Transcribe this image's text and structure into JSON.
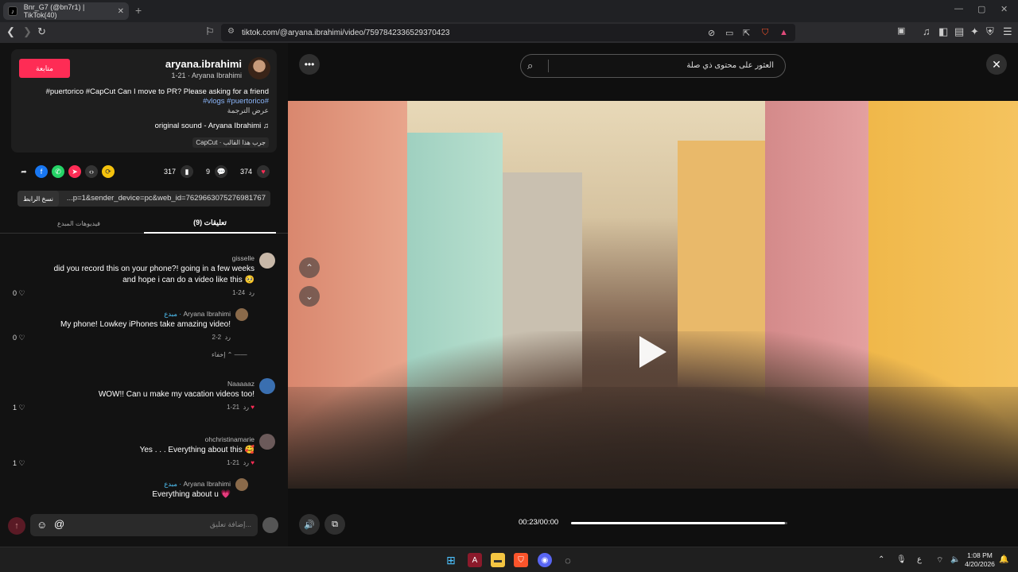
{
  "browser": {
    "tab_title": "Bnr_G7 (@bn7r1) | TikTok(40)",
    "url": "tiktok.com/@aryana.ibrahimi/video/7597842336529370423",
    "new_tab": "+",
    "close_tab": "✕"
  },
  "post": {
    "follow_label": "متابعة",
    "username": "aryana.ibrahimi",
    "subline": "1-21 · Aryana Ibrahimi",
    "desc_main": "#puertorico #CapCut Can I move to PR? Please asking for a friend",
    "desc_tags": "#vlogs #puertorico#",
    "translate": "عرض الترجمة",
    "sound": "original sound - Aryana Ibrahimi ♫",
    "capcut": "CapCut · جرب هذا القالب",
    "likes": "374",
    "comments_count": "9",
    "saves": "317",
    "copy_link": "نسخ الرابط",
    "link": "...p=1&sender_device=pc&web_id=7629663075276981767",
    "tab_comments": "تعليقات (9)",
    "tab_creator": "فيديوهات المبدع"
  },
  "comments": [
    {
      "name": "gisselle",
      "text1": "did you record this on your phone?! going in a few weeks",
      "text2": "and hope i can do a video like this 🥺",
      "date": "1-24",
      "reply": "رد",
      "likes": "0"
    },
    {
      "name": "Aryana Ibrahimi",
      "creator": "مبدع ·",
      "text1": "My phone! Lowkey iPhones take amazing video!",
      "date": "2-2",
      "reply": "رد",
      "likes": "0",
      "hide": "إخفاء ⌃"
    },
    {
      "name": "Naaaaaz",
      "text1": "WOW!! Can u make my vacation videos too!",
      "date": "1-21",
      "reply": "رد",
      "likes": "1"
    },
    {
      "name": "ohchristinamarie",
      "text1": "Yes . . . Everything about this 🥰",
      "date": "1-21",
      "reply": "رد",
      "likes": "1"
    },
    {
      "name": "Aryana Ibrahimi",
      "creator": "مبدع ·",
      "text1": "Everything about u 💗"
    }
  ],
  "input": {
    "placeholder": "إضافة تعليق..."
  },
  "video": {
    "search_placeholder": "العثور على محتوى ذي صلة",
    "time": "00:23/00:00",
    "progress": 0.99
  },
  "taskbar": {
    "time": "1:08 PM",
    "date": "4/20/2026",
    "lang": "ع"
  },
  "colors": {
    "accent": "#fe2c55",
    "tag": "#8ab4f8"
  }
}
